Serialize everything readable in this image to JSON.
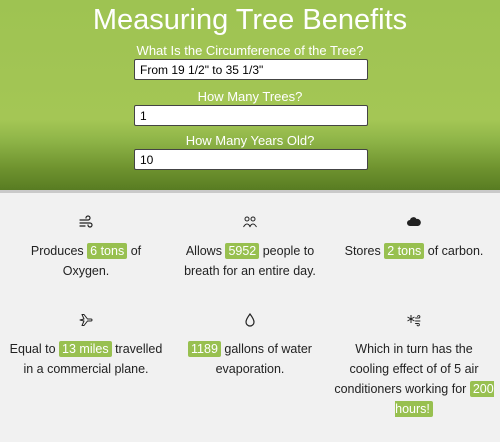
{
  "header": {
    "title": "Measuring Tree Benefits",
    "q_circumference": "What Is the Circumference of the Tree?",
    "circumference_value": "From 19 1/2\" to 35 1/3\"",
    "q_trees": "How Many Trees?",
    "trees_value": "1",
    "q_years": "How Many Years Old?",
    "years_value": "10"
  },
  "benefits": [
    {
      "icon": "wind-icon",
      "pre": "Produces",
      "value": "6 tons",
      "post": "of Oxygen."
    },
    {
      "icon": "people-icon",
      "pre": "Allows",
      "value": "5952",
      "post": "people to breath for an entire day."
    },
    {
      "icon": "cloud-icon",
      "pre": "Stores",
      "value": "2 tons",
      "post": "of carbon."
    },
    {
      "icon": "airplane-icon",
      "pre": "Equal to",
      "value": "13 miles",
      "post": "travelled in a commercial plane."
    },
    {
      "icon": "water-drop-icon",
      "pre": "",
      "value": "1189",
      "post": "gallons of water evaporation."
    },
    {
      "icon": "snowflake-wind-icon",
      "pre": "Which in turn has the cooling effect of of 5 air conditioners working for",
      "value": "200 hours!",
      "post": ""
    }
  ],
  "colors": {
    "accent": "#98c050",
    "header_top": "#a4c655",
    "header_bottom": "#587c22"
  }
}
